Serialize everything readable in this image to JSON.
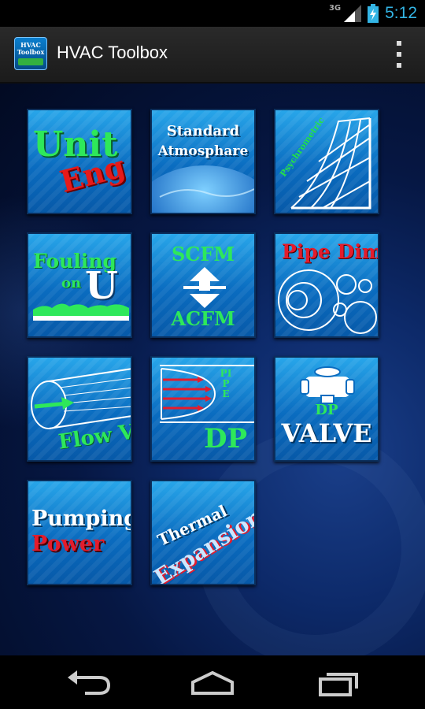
{
  "status_bar": {
    "network": "3G",
    "time": "5:12",
    "icons": [
      "signal-icon",
      "battery-charging-icon"
    ]
  },
  "action_bar": {
    "app_icon_text": "HVAC Toolbox",
    "title": "HVAC Toolbox",
    "overflow_icon": "overflow-menu-icon"
  },
  "tiles": {
    "unit_eng": {
      "line1": "Unit",
      "line2": "Eng"
    },
    "standard_atmosphere": {
      "line1": "Standard",
      "line2": "Atmosphare"
    },
    "psychrometric": {
      "label": "Psychrometric"
    },
    "fouling": {
      "line1": "Fouling",
      "line2": "on",
      "line3": "U"
    },
    "scfm_acfm": {
      "top": "SCFM",
      "bottom": "ACFM"
    },
    "pipe_dim": {
      "label": "Pipe Dim"
    },
    "flow_v": {
      "label": "Flow V"
    },
    "pipe_dp": {
      "vertical": "PIPE",
      "label": "DP"
    },
    "dp_valve": {
      "line1": "DP",
      "line2": "VALVE"
    },
    "pumping_power": {
      "line1": "Pumping",
      "line2": "Power"
    },
    "thermal_expansion": {
      "line1": "Thermal",
      "line2": "Expansion"
    }
  },
  "nav_bar": {
    "icons": [
      "back-icon",
      "home-icon",
      "recent-apps-icon"
    ]
  },
  "colors": {
    "accent": "#33b5e5",
    "tile_top": "#28a6ea",
    "tile_bottom": "#0759a8",
    "green": "#22e04a",
    "red": "#e41c2c"
  }
}
